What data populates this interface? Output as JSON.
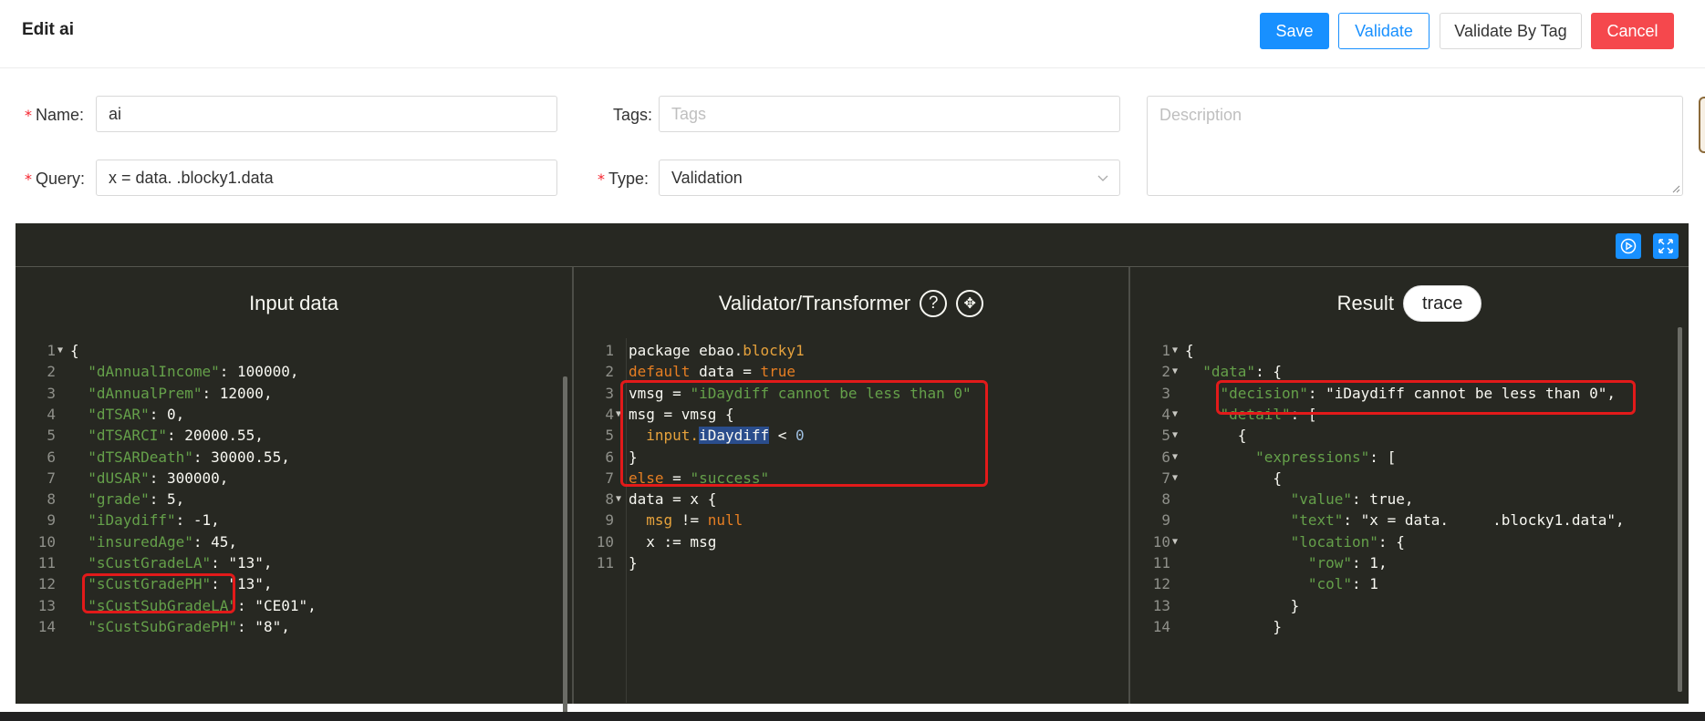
{
  "header": {
    "title": "Edit ai",
    "save": "Save",
    "validate": "Validate",
    "validate_by_tag": "Validate By Tag",
    "cancel": "Cancel"
  },
  "form": {
    "name_label": "Name:",
    "name_value": "ai",
    "tags_label": "Tags:",
    "tags_placeholder": "Tags",
    "description_placeholder": "Description",
    "query_label": "Query:",
    "query_value": "x = data.       .blocky1.data",
    "type_label": "Type:",
    "type_value": "Validation"
  },
  "editor": {
    "input_title": "Input data",
    "validator_title": "Validator/Transformer",
    "result_title": "Result",
    "trace_label": "trace",
    "input_lines": [
      "{",
      "  \"dAnnualIncome\": 100000,",
      "  \"dAnnualPrem\": 12000,",
      "  \"dTSAR\": 0,",
      "  \"dTSARCI\": 20000.55,",
      "  \"dTSARDeath\": 30000.55,",
      "  \"dUSAR\": 300000,",
      "  \"grade\": 5,",
      "  \"iDaydiff\": -1,",
      "  \"insuredAge\": 45,",
      "  \"sCustGradeLA\": \"13\",",
      "  \"sCustGradePH\": \"13\",",
      "  \"sCustSubGradeLA\": \"CE01\",",
      "  \"sCustSubGradePH\": \"8\","
    ],
    "validator_lines": [
      "package ebao.blocky1",
      "default data = true",
      "vmsg = \"iDaydiff cannot be less than 0\"",
      "msg = vmsg {",
      "  input.iDaydiff < 0",
      "}",
      "else = \"success\"",
      "data = x {",
      "  msg != null",
      "  x := msg",
      "}"
    ],
    "result_lines": [
      "{",
      "  \"data\": {",
      "    \"decision\": \"iDaydiff cannot be less than 0\",",
      "    \"detail\": [",
      "      {",
      "        \"expressions\": [",
      "          {",
      "            \"value\": true,",
      "            \"text\": \"x = data.     .blocky1.data\",",
      "            \"location\": {",
      "              \"row\": 1,",
      "              \"col\": 1",
      "            }",
      "          }"
    ]
  }
}
